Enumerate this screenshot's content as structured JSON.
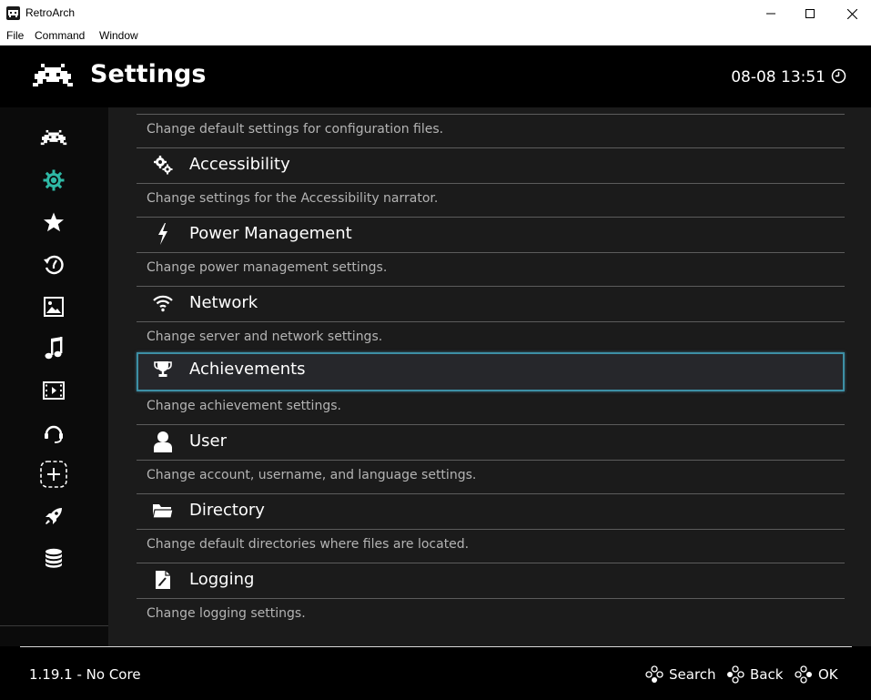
{
  "window": {
    "title": "RetroArch",
    "icon": "retroarch-logo-icon",
    "controls": [
      "minimize-icon",
      "maximize-icon",
      "close-icon"
    ]
  },
  "menubar": {
    "items": [
      "File",
      "Command",
      "Window"
    ]
  },
  "header": {
    "title": "Settings",
    "clock": "08-08 13:51",
    "clock_icon": "clock-icon"
  },
  "sidebar": {
    "items": [
      {
        "name": "main-menu",
        "icon": "retroarch-invader-icon"
      },
      {
        "name": "settings",
        "icon": "gear-icon",
        "active": true
      },
      {
        "name": "favorites",
        "icon": "star-icon"
      },
      {
        "name": "history",
        "icon": "history-icon"
      },
      {
        "name": "images",
        "icon": "image-icon"
      },
      {
        "name": "music",
        "icon": "music-icon"
      },
      {
        "name": "video",
        "icon": "film-icon"
      },
      {
        "name": "netplay",
        "icon": "netplay-icon"
      },
      {
        "name": "import-content",
        "icon": "add-icon"
      },
      {
        "name": "explore",
        "icon": "rocket-icon"
      },
      {
        "name": "database",
        "icon": "database-icon"
      }
    ],
    "active_color": "#2fb9a6"
  },
  "list": {
    "top_description": "Change default settings for configuration files.",
    "items": [
      {
        "label": "Accessibility",
        "description": "Change settings for the Accessibility narrator.",
        "icon": "accessibility-gears-icon"
      },
      {
        "label": "Power Management",
        "description": "Change power management settings.",
        "icon": "lightning-icon"
      },
      {
        "label": "Network",
        "description": "Change server and network settings.",
        "icon": "wifi-icon"
      },
      {
        "label": "Achievements",
        "description": "Change achievement settings.",
        "icon": "trophy-icon",
        "selected": true
      },
      {
        "label": "User",
        "description": "Change account, username, and language settings.",
        "icon": "user-icon"
      },
      {
        "label": "Directory",
        "description": "Change default directories where files are located.",
        "icon": "folder-icon"
      },
      {
        "label": "Logging",
        "description": "Change logging settings.",
        "icon": "log-file-icon"
      }
    ],
    "selection_color": "#3d8fa5"
  },
  "footer": {
    "version": "1.19.1 - No Core",
    "buttons": [
      {
        "label": "Search",
        "icon": "gamepad-buttons-icon"
      },
      {
        "label": "Back",
        "icon": "gamepad-buttons-icon"
      },
      {
        "label": "OK",
        "icon": "gamepad-buttons-icon"
      }
    ]
  }
}
